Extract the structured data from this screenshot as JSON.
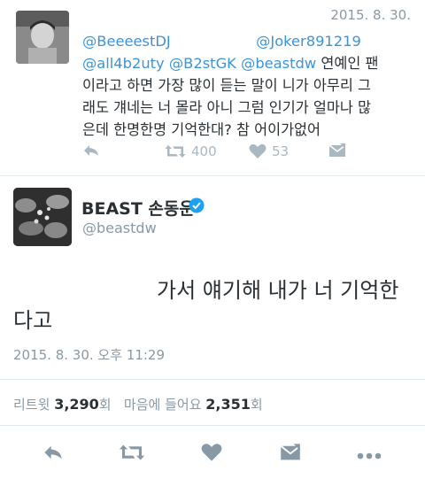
{
  "reply": {
    "date": "2015. 8. 30.",
    "mentions": [
      "@BeeeestDJ",
      "@Joker891219",
      "@all4b2uty",
      "@B2stGK",
      "@beastdw"
    ],
    "text_lines": [
      "연예인 팬",
      "이라고 하면 가장 많이 듣는 말이 니가 아무리 그",
      "래도 걔네는 너 몰라 아니 그럼 인기가 얼마나 많",
      "은데 한명한명 기억한대? 참 어이가없어"
    ],
    "retweet_count": "400",
    "like_count": "53"
  },
  "tweet": {
    "author_name": "BEAST 손동운",
    "handle": "@beastdw",
    "text_line1": "가서 얘기해 내가 너 기억한",
    "text_line2": "다고",
    "timestamp": "2015. 8. 30. 오후 11:29",
    "retweets_label": "리트윗",
    "retweets_count": "3,290",
    "likes_label": "마음에 들어요",
    "likes_count": "2,351",
    "count_unit": "회"
  },
  "icons": [
    "reply-icon",
    "retweet-icon",
    "heart-icon",
    "message-icon",
    "more-icon",
    "verified-icon"
  ],
  "colors": {
    "link": "#3b94d9",
    "muted": "#8899a6",
    "icon": "#aab8c2",
    "main_icon": "#8899a6",
    "verified": "#1da1f2"
  }
}
